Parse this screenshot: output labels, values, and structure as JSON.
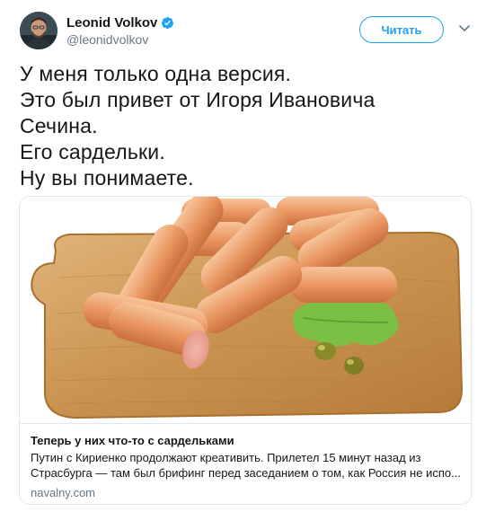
{
  "author": {
    "display_name": "Leonid Volkov",
    "handle": "@leonidvolkov",
    "verified": true,
    "avatar_icon": "person-avatar"
  },
  "actions": {
    "follow_label": "Читать",
    "caret_icon": "chevron-down-icon"
  },
  "tweet": {
    "lines": [
      "У меня только одна версия.",
      "Это был привет от Игоря Ивановича",
      "Сечина.",
      "Его сардельки.",
      "Ну вы понимаете."
    ]
  },
  "card": {
    "image_subject": "sausages-on-cutting-board",
    "title": "Теперь у них что-то с сардельками",
    "description_lines": [
      "Путин с Кириенко продолжают креативить. Прилетел 15 минут назад из",
      "Страсбурга — там был брифинг перед заседанием о том, как Россия не испо..."
    ],
    "domain": "navalny.com"
  },
  "colors": {
    "accent": "#1da1f2",
    "text": "#14171a",
    "muted": "#657786",
    "border": "#e1e8ed"
  }
}
